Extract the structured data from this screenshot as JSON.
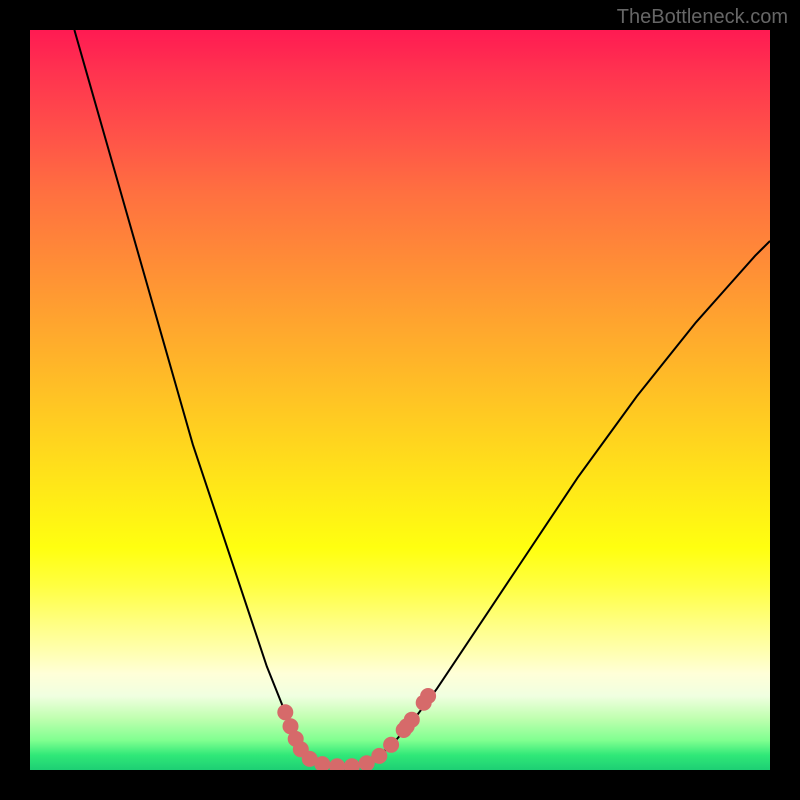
{
  "watermark": "TheBottleneck.com",
  "chart_data": {
    "type": "line",
    "title": "",
    "xlabel": "",
    "ylabel": "",
    "curve_points": [
      {
        "x": 0.06,
        "y": 1.0
      },
      {
        "x": 0.08,
        "y": 0.93
      },
      {
        "x": 0.1,
        "y": 0.86
      },
      {
        "x": 0.12,
        "y": 0.79
      },
      {
        "x": 0.14,
        "y": 0.72
      },
      {
        "x": 0.16,
        "y": 0.65
      },
      {
        "x": 0.18,
        "y": 0.58
      },
      {
        "x": 0.2,
        "y": 0.51
      },
      {
        "x": 0.22,
        "y": 0.44
      },
      {
        "x": 0.24,
        "y": 0.38
      },
      {
        "x": 0.26,
        "y": 0.32
      },
      {
        "x": 0.28,
        "y": 0.26
      },
      {
        "x": 0.3,
        "y": 0.2
      },
      {
        "x": 0.32,
        "y": 0.14
      },
      {
        "x": 0.34,
        "y": 0.09
      },
      {
        "x": 0.355,
        "y": 0.05
      },
      {
        "x": 0.37,
        "y": 0.025
      },
      {
        "x": 0.39,
        "y": 0.012
      },
      {
        "x": 0.41,
        "y": 0.006
      },
      {
        "x": 0.43,
        "y": 0.005
      },
      {
        "x": 0.45,
        "y": 0.008
      },
      {
        "x": 0.47,
        "y": 0.018
      },
      {
        "x": 0.49,
        "y": 0.035
      },
      {
        "x": 0.52,
        "y": 0.07
      },
      {
        "x": 0.55,
        "y": 0.11
      },
      {
        "x": 0.58,
        "y": 0.155
      },
      {
        "x": 0.62,
        "y": 0.215
      },
      {
        "x": 0.66,
        "y": 0.275
      },
      {
        "x": 0.7,
        "y": 0.335
      },
      {
        "x": 0.74,
        "y": 0.395
      },
      {
        "x": 0.78,
        "y": 0.45
      },
      {
        "x": 0.82,
        "y": 0.505
      },
      {
        "x": 0.86,
        "y": 0.555
      },
      {
        "x": 0.9,
        "y": 0.605
      },
      {
        "x": 0.94,
        "y": 0.65
      },
      {
        "x": 0.98,
        "y": 0.695
      },
      {
        "x": 1.0,
        "y": 0.715
      }
    ],
    "marker_points": [
      {
        "x": 0.345,
        "y": 0.078
      },
      {
        "x": 0.352,
        "y": 0.059
      },
      {
        "x": 0.359,
        "y": 0.042
      },
      {
        "x": 0.366,
        "y": 0.028
      },
      {
        "x": 0.378,
        "y": 0.015
      },
      {
        "x": 0.395,
        "y": 0.008
      },
      {
        "x": 0.415,
        "y": 0.005
      },
      {
        "x": 0.435,
        "y": 0.005
      },
      {
        "x": 0.455,
        "y": 0.009
      },
      {
        "x": 0.472,
        "y": 0.019
      },
      {
        "x": 0.488,
        "y": 0.034
      },
      {
        "x": 0.505,
        "y": 0.054
      },
      {
        "x": 0.509,
        "y": 0.059
      },
      {
        "x": 0.516,
        "y": 0.068
      },
      {
        "x": 0.532,
        "y": 0.091
      },
      {
        "x": 0.538,
        "y": 0.1
      }
    ],
    "gradient_colors": {
      "top": "#ff1a52",
      "middle": "#ffff10",
      "bottom": "#1dcf74"
    }
  }
}
